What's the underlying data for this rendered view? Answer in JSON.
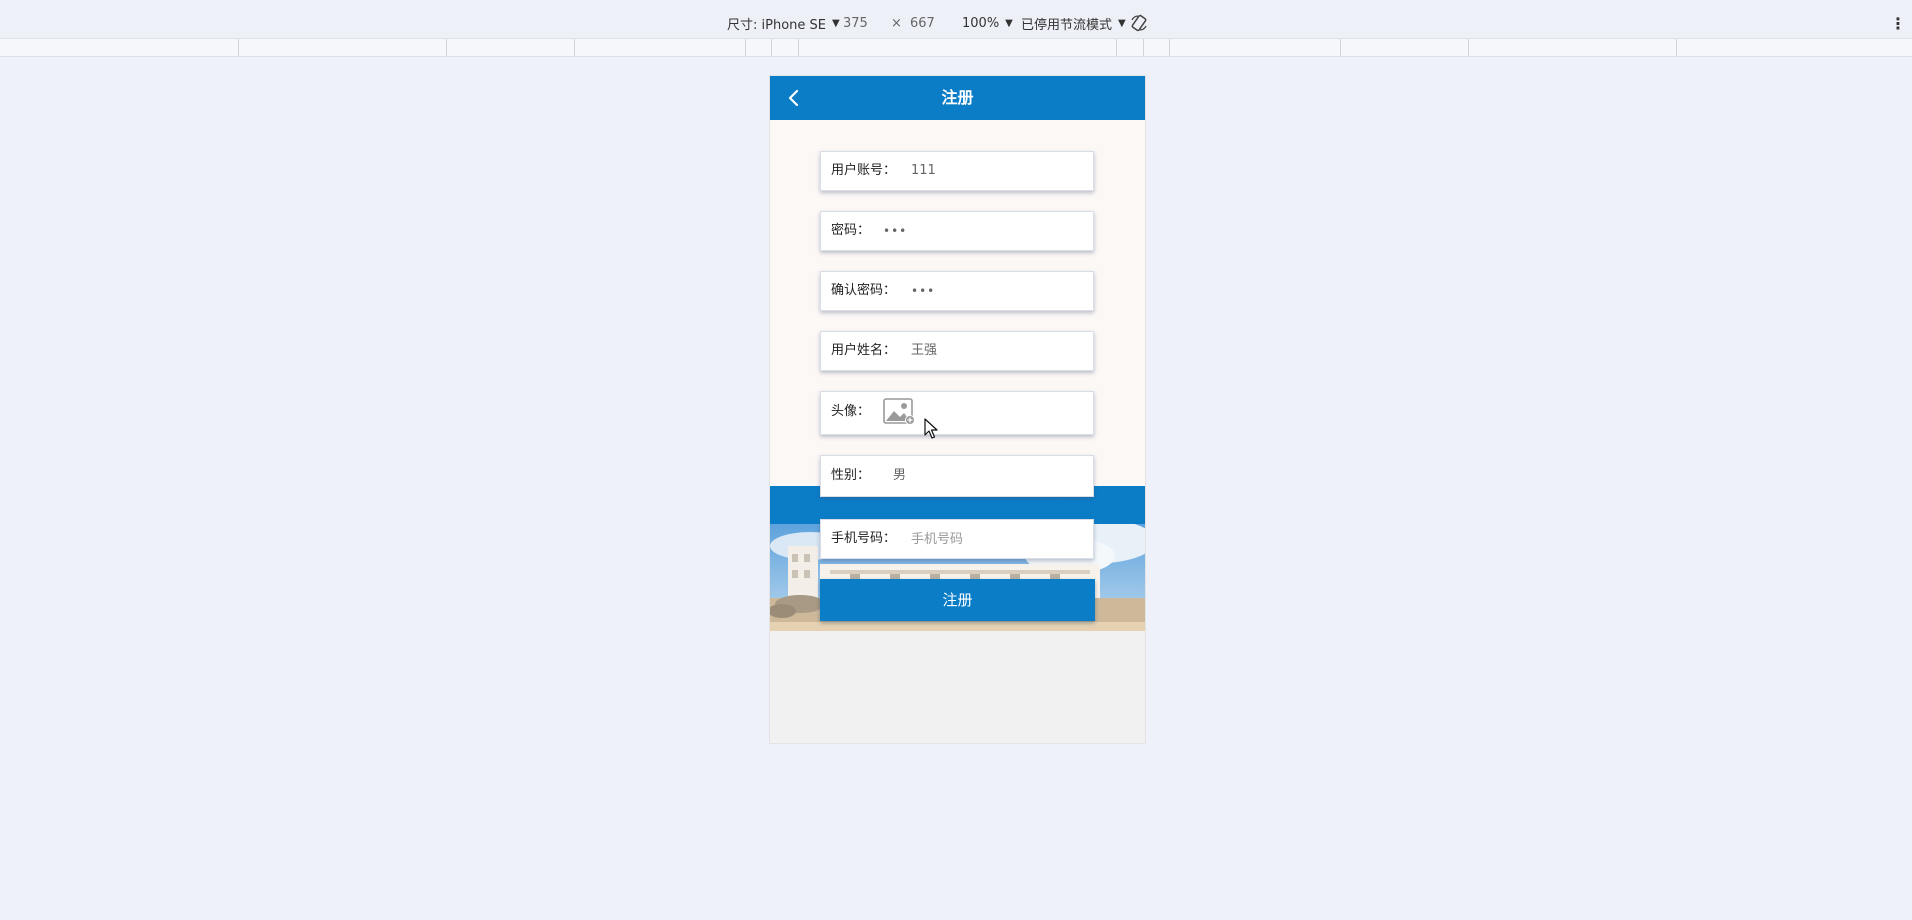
{
  "devtools": {
    "device_label": "尺寸: iPhone SE",
    "width": "375",
    "times": "×",
    "height": "667",
    "zoom": "100%",
    "throttle": "已停用节流模式",
    "more": "⋮"
  },
  "header": {
    "title": "注册"
  },
  "form": {
    "account": {
      "label": "用户账号：",
      "value": "111"
    },
    "password": {
      "label": "密码：",
      "value": "•••"
    },
    "confirm_password": {
      "label": "确认密码：",
      "value": "•••"
    },
    "name": {
      "label": "用户姓名：",
      "value": "王强"
    },
    "avatar": {
      "label": "头像："
    },
    "gender": {
      "label": "性别：",
      "value": "男"
    },
    "phone": {
      "label": "手机号码：",
      "placeholder": "手机号码"
    }
  },
  "submit": {
    "label": "注册"
  },
  "colors": {
    "primary": "#0b7dc7",
    "page_bg": "#eef1fa",
    "form_bg": "#fcf8f6"
  },
  "icons": {
    "back": "chevron-left-icon",
    "avatar": "image-placeholder-icon",
    "rotate": "rotate-device-icon",
    "more": "more-vertical-icon",
    "cursor": "mouse-pointer-icon"
  }
}
